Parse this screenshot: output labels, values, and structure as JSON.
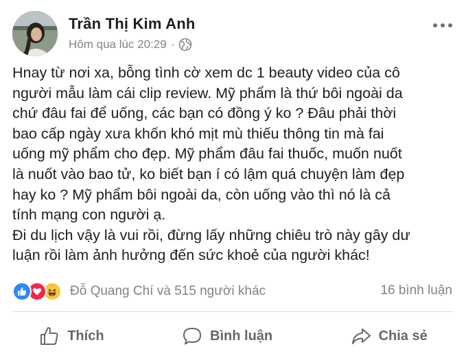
{
  "post": {
    "author": "Trần Thị Kim Anh",
    "timestamp": "Hôm qua lúc 20:29",
    "separator": "·",
    "privacy_icon": "globe-icon",
    "menu_icon": "more-horizontal-icon",
    "text_lines": [
      "Hnay từ nơi xa, bỗng tình cờ xem dc 1 beauty video của cô",
      "người mẫu làm cái clip review. Mỹ phẩm là thứ bôi ngoài da",
      "chứ đâu fai để uống, các bạn có đồng ý ko ? Đâu phải thời",
      "bao cấp ngày xưa khốn khó mịt mù thiếu thông tin mà fai",
      "uống mỹ phẩm cho đẹp. Mỹ phẩm đâu fai thuốc, muốn nuốt",
      "là nuốt vào bao tử, ko biết bạn í có lậm quá chuyện làm đẹp",
      "hay ko ? Mỹ phẩm bôi ngoài da, còn uống vào thì nó là cả",
      "tính mạng con người ạ.",
      "Đi du lịch vậy là vui rồi, đừng lấy những chiêu trò này gây dư",
      "luận rồi làm ảnh hưởng đến sức khoẻ của người khác!"
    ]
  },
  "reactions": {
    "icons": [
      "like-reaction-icon",
      "love-reaction-icon",
      "haha-reaction-icon"
    ],
    "colors": {
      "like": "#2d88ff",
      "love": "#f0284a",
      "haha": "#f7c73b"
    },
    "summary": "Đỗ Quang Chí và 515 người khác",
    "comments": "16 bình luận"
  },
  "actions": {
    "like_label": "Thích",
    "comment_label": "Bình luận",
    "share_label": "Chia sẻ"
  }
}
